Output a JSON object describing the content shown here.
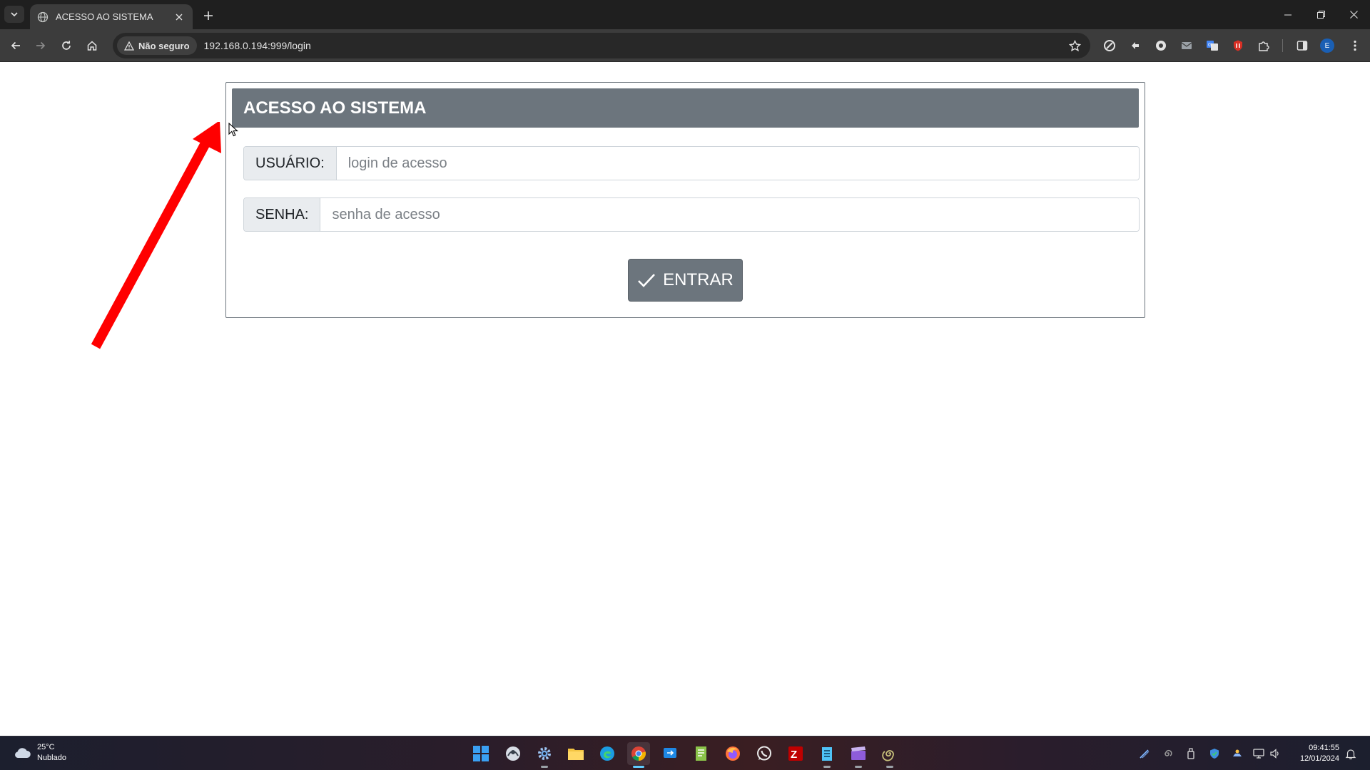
{
  "browser": {
    "tab_title": "ACESSO AO SISTEMA",
    "security_label": "Não seguro",
    "url": "192.168.0.194:999/login",
    "profile_initial": "E"
  },
  "login": {
    "header": "ACESSO AO SISTEMA",
    "user_label": "USUÁRIO:",
    "user_placeholder": "login de acesso",
    "user_value": "",
    "password_label": "SENHA:",
    "password_placeholder": "senha de acesso",
    "password_value": "",
    "submit_label": "ENTRAR"
  },
  "taskbar": {
    "weather_temp": "25°C",
    "weather_desc": "Nublado",
    "time": "09:41:55",
    "date": "12/01/2024"
  },
  "colors": {
    "header_bg": "#6c757d",
    "button_bg": "#6c757d",
    "annotation_arrow": "#ff0000",
    "browser_dark": "#3c3c3c"
  }
}
